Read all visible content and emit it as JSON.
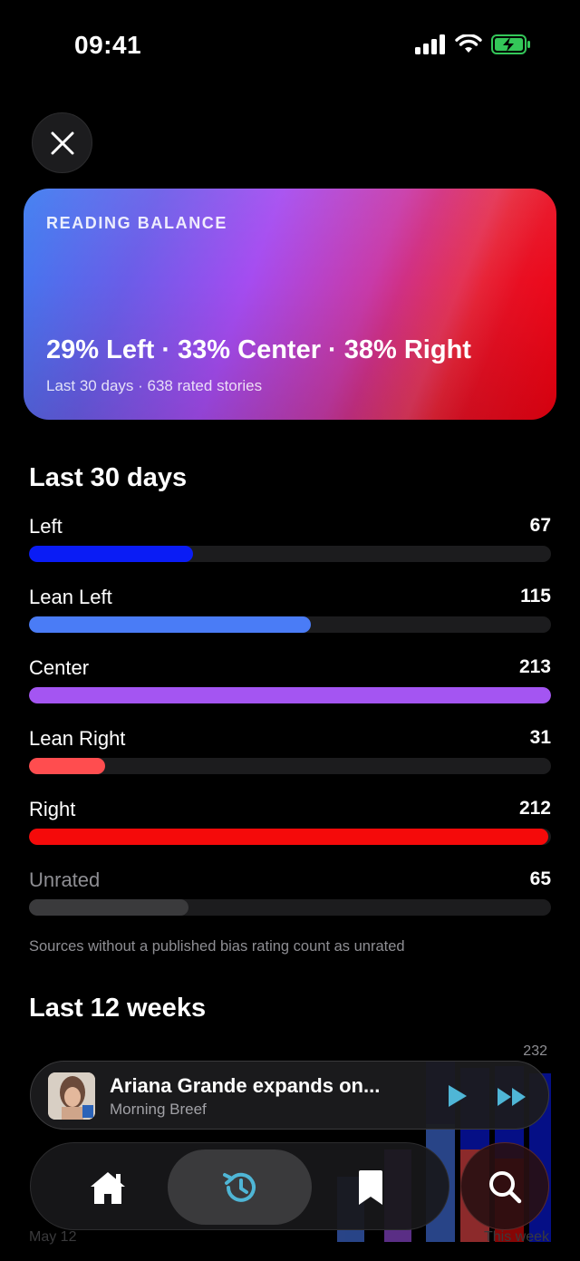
{
  "status_bar": {
    "time": "09:41"
  },
  "card": {
    "eyebrow": "READING BALANCE",
    "headline": "29% Left · 33% Center · 38% Right",
    "subtitle": "Last 30 days · 638 rated stories"
  },
  "section_30": {
    "title": "Last 30 days",
    "note": "Sources without a published bias rating count as unrated"
  },
  "bars": [
    {
      "label": "Left",
      "value": "67",
      "fraction": 0.314,
      "color": "#0a1cf5",
      "label_color": "#ffffff"
    },
    {
      "label": "Lean Left",
      "value": "115",
      "fraction": 0.54,
      "color": "#4a7cf6",
      "label_color": "#ffffff"
    },
    {
      "label": "Center",
      "value": "213",
      "fraction": 1.0,
      "color": "#a455f2",
      "label_color": "#ffffff"
    },
    {
      "label": "Lean Right",
      "value": "31",
      "fraction": 0.146,
      "color": "#ff4d4f",
      "label_color": "#ffffff"
    },
    {
      "label": "Right",
      "value": "212",
      "fraction": 0.995,
      "color": "#f50a0a",
      "label_color": "#ffffff"
    },
    {
      "label": "Unrated",
      "value": "65",
      "fraction": 0.305,
      "color": "#3a3a3c",
      "label_color": "#8e8e93"
    }
  ],
  "section_12": {
    "title": "Last 12 weeks",
    "max_label": "232",
    "axis_start": "May 12",
    "axis_end": "This week"
  },
  "now_playing": {
    "title": "Ariana Grande expands on...",
    "subtitle": "Morning Breef",
    "play_icon": "play-icon",
    "skip_icon": "fast-forward-icon",
    "accent": "#4fb6d6"
  },
  "tab_bar": {
    "tabs": [
      {
        "name": "home",
        "icon": "home-icon",
        "active": false
      },
      {
        "name": "history",
        "icon": "history-icon",
        "active": true
      },
      {
        "name": "saved",
        "icon": "bookmark-icon",
        "active": false
      }
    ],
    "search_icon": "search-icon"
  },
  "colors": {
    "background": "#000000",
    "left": "#0a1cf5",
    "lean_left": "#4a7cf6",
    "center": "#a455f2",
    "lean_right": "#ff4d4f",
    "right": "#f50a0a",
    "accent": "#4fb6d6"
  }
}
